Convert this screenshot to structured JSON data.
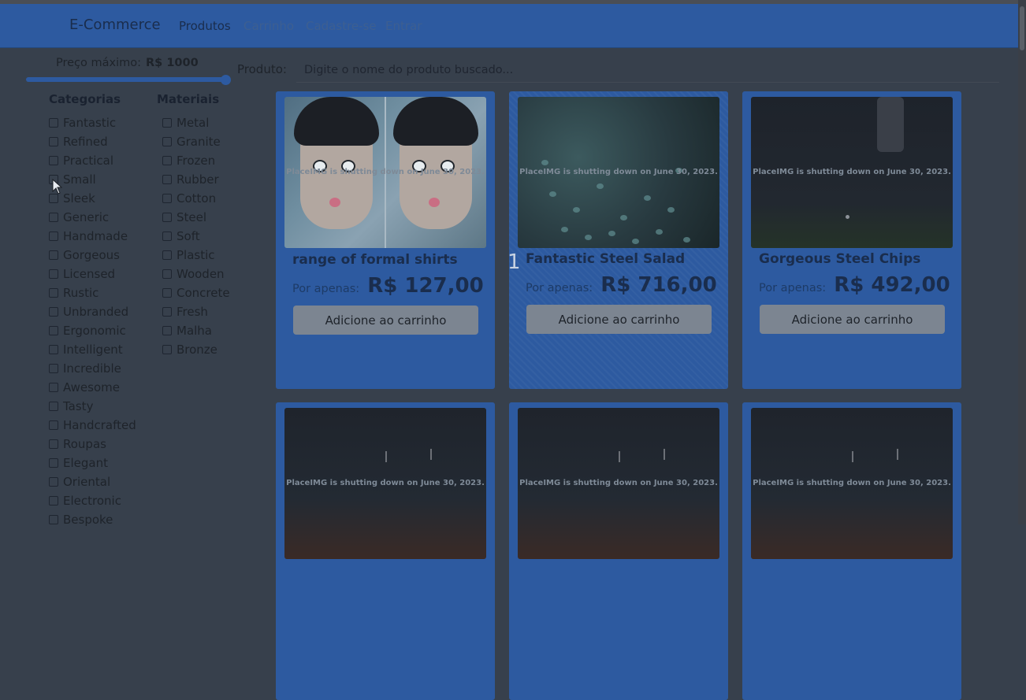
{
  "navbar": {
    "brand": "E-Commerce",
    "links": [
      "Produtos",
      "Carrinho",
      "Cadastre-se",
      "Entrar"
    ]
  },
  "filters": {
    "price_label": "Preço máximo:",
    "price_value": "R$ 1000",
    "price_slider_fraction": 1.0,
    "categories_title": "Categorias",
    "materials_title": "Materiais",
    "categories": [
      "Fantastic",
      "Refined",
      "Practical",
      "Small",
      "Sleek",
      "Generic",
      "Handmade",
      "Gorgeous",
      "Licensed",
      "Rustic",
      "Unbranded",
      "Ergonomic",
      "Intelligent",
      "Incredible",
      "Awesome",
      "Tasty",
      "Handcrafted",
      "Roupas",
      "Elegant",
      "Oriental",
      "Electronic",
      "Bespoke"
    ],
    "materials": [
      "Metal",
      "Granite",
      "Frozen",
      "Rubber",
      "Cotton",
      "Steel",
      "Soft",
      "Plastic",
      "Wooden",
      "Concrete",
      "Fresh",
      "Malha",
      "Bronze"
    ]
  },
  "search": {
    "label": "Produto:",
    "placeholder": "Digite o nome do produto buscado..."
  },
  "products": [
    {
      "name": "range of formal shirts",
      "price_prefix": "Por apenas:",
      "price": "R$ 127,00",
      "button": "Adicione ao carrinho",
      "image_note": "PlaceIMG is shutting down on June 30, 2023."
    },
    {
      "name": "Fantastic Steel Salad",
      "price_prefix": "Por apenas:",
      "price": "R$ 716,00",
      "button": "Adicione ao carrinho",
      "image_note": "PlaceIMG is shutting down on June 30, 2023."
    },
    {
      "name": "Gorgeous Steel Chips",
      "price_prefix": "Por apenas:",
      "price": "R$ 492,00",
      "button": "Adicione ao carrinho",
      "image_note": "PlaceIMG is shutting down on June 30, 2023."
    },
    {
      "image_note": "PlaceIMG is shutting down on June 30, 2023."
    },
    {
      "image_note": "PlaceIMG is shutting down on June 30, 2023."
    },
    {
      "image_note": "PlaceIMG is shutting down on June 30, 2023."
    }
  ],
  "overlay": {
    "floating_number": "1"
  },
  "colors": {
    "navbar": "#2d5aa0",
    "card": "#2d5aa0",
    "background": "#37404c",
    "button": "#7c8591"
  }
}
